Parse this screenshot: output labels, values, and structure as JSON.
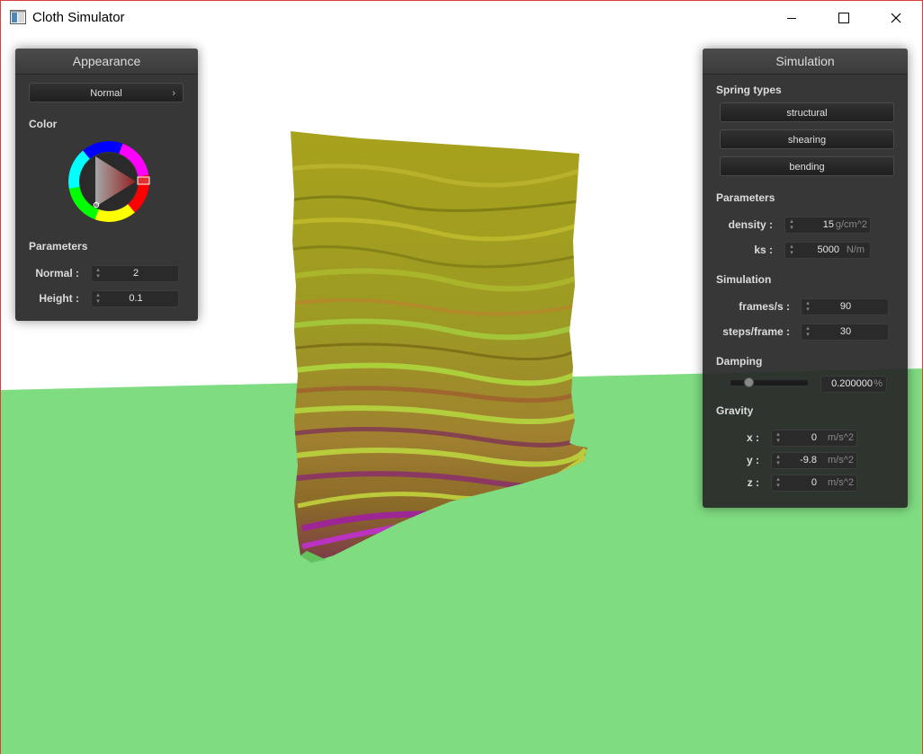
{
  "window": {
    "title": "Cloth Simulator",
    "controls": {
      "minimize": "minimize-icon",
      "maximize": "maximize-icon",
      "close": "close-icon"
    }
  },
  "colors": {
    "background": "#404040",
    "floor": "#7fdc81",
    "panel": "#282828",
    "selected_color": "#e03030"
  },
  "appearance": {
    "title": "Appearance",
    "shader_label": "Normal",
    "color_label": "Color",
    "parameters_label": "Parameters",
    "normal_label": "Normal :",
    "normal_value": "2",
    "height_label": "Height :",
    "height_value": "0.1"
  },
  "simulation": {
    "title": "Simulation",
    "spring_types_label": "Spring types",
    "structural_label": "structural",
    "shearing_label": "shearing",
    "bending_label": "bending",
    "parameters_label": "Parameters",
    "density_label": "density :",
    "density_value": "15",
    "density_unit": "g/cm^2",
    "ks_label": "ks :",
    "ks_value": "5000",
    "ks_unit": "N/m",
    "simulation_label": "Simulation",
    "fps_label": "frames/s :",
    "fps_value": "90",
    "steps_label": "steps/frame :",
    "steps_value": "30",
    "damping_label": "Damping",
    "damping_value": "0.200000",
    "damping_unit": "%",
    "damping_fraction": 0.2,
    "gravity_label": "Gravity",
    "gx_label": "x :",
    "gx_value": "0",
    "gy_label": "y :",
    "gy_value": "-9.8",
    "gz_label": "z :",
    "gz_value": "0",
    "gravity_unit": "m/s^2"
  }
}
